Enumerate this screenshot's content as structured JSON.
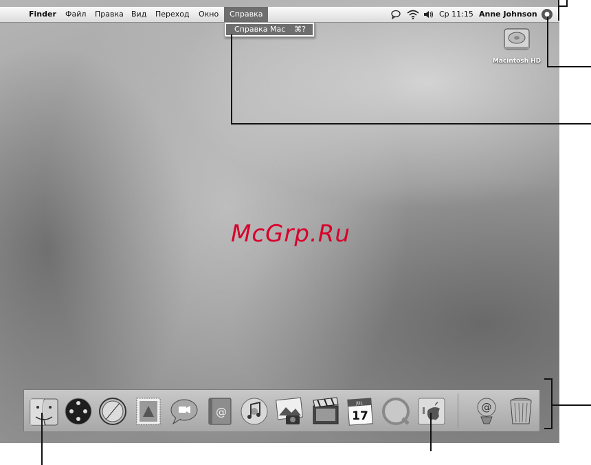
{
  "menubar": {
    "apple_glyph": "",
    "items": [
      "Finder",
      "Файл",
      "Правка",
      "Вид",
      "Переход",
      "Окно",
      "Справка"
    ],
    "active_item": "Справка",
    "clock": "Ср 11:15",
    "user": "Anne Johnson",
    "status_icons": [
      "ichat-status-icon",
      "wifi-icon",
      "volume-icon"
    ],
    "spotlight_icon": "spotlight-icon"
  },
  "dropdown": {
    "item_label": "Справка Mac",
    "shortcut": "⌘?"
  },
  "desktop": {
    "hd_label": "Macintosh HD",
    "watermark": "McGrp.Ru"
  },
  "dock": {
    "apps": [
      "finder",
      "dashboard",
      "safari",
      "mail",
      "ichat",
      "address-book",
      "itunes",
      "iphoto",
      "imovie",
      "ical",
      "quicktime",
      "system-preferences"
    ],
    "right": [
      "downloads-stack",
      "trash"
    ],
    "ical_day": "17",
    "ical_month": "JUL"
  },
  "colors": {
    "menu_highlight": "#6e6e6e",
    "watermark": "#d7002a"
  }
}
